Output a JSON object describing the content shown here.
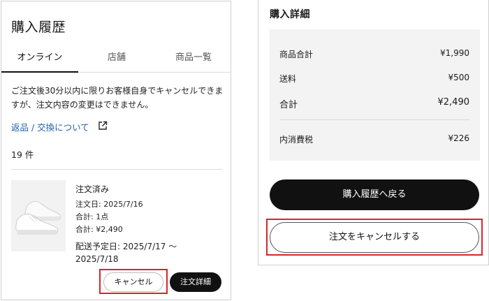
{
  "left": {
    "title": "購入履歴",
    "tabs": [
      {
        "label": "オンライン",
        "active": true
      },
      {
        "label": "店舗",
        "active": false
      },
      {
        "label": "商品一覧",
        "active": false
      }
    ],
    "notice": "ご注文後30分以内に限りお客様自身でキャンセルできますが、注文内容の変更はできません。",
    "return_link": "返品 / 交換について",
    "count": "19 件",
    "order": {
      "status": "注文済み",
      "order_date": "注文日: 2025/7/16",
      "quantity": "合計: 1点",
      "total": "合計: ¥2,490",
      "delivery": "配送予定日: 2025/7/17 ～ 2025/7/18"
    },
    "cancel_label": "キャンセル",
    "detail_label": "注文詳細"
  },
  "right": {
    "title": "購入詳細",
    "rows": [
      {
        "label": "商品合計",
        "value": "¥1,990"
      },
      {
        "label": "送料",
        "value": "¥500"
      },
      {
        "label": "合計",
        "value": "¥2,490"
      },
      {
        "label": "内消費税",
        "value": "¥226"
      }
    ],
    "back_label": "購入履歴へ戻る",
    "cancel_order_label": "注文をキャンセルする"
  },
  "colors": {
    "accent_link": "#1f5fa8",
    "highlight": "#d6262c",
    "primary_button": "#111111"
  },
  "icons": [
    "external-link-icon",
    "sneaker-product-image"
  ]
}
